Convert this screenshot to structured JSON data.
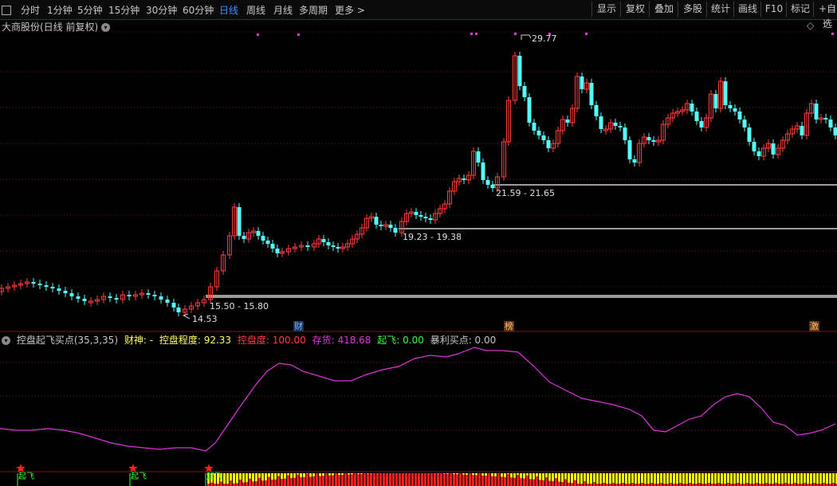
{
  "toolbar": {
    "timeframes": [
      "分时",
      "1分钟",
      "5分钟",
      "15分钟",
      "30分钟",
      "60分钟",
      "日线",
      "周线",
      "月线",
      "多周期",
      "更多 >"
    ],
    "active_timeframe": "日线",
    "buttons": [
      "显示",
      "复权",
      "叠加",
      "多股",
      "统计",
      "画线",
      "F10",
      "标记",
      "+自选"
    ]
  },
  "stock": {
    "title": "大商股份(日线 前复权)"
  },
  "price_labels": {
    "high": "29.77",
    "low": "14.53",
    "zone1": "15.50 - 15.80",
    "zone2": "19.23 - 19.38",
    "zone3": "21.59 - 21.65"
  },
  "event_tags": [
    {
      "text": "财",
      "color": "#4a8cd6"
    },
    {
      "text": "榜",
      "color": "#e08a2a"
    },
    {
      "text": "激",
      "color": "#e08a2a"
    }
  ],
  "indicator": {
    "name": "控盘起飞买点(35,3,35)",
    "caishen": "财神: -",
    "control_degree_label": "控盘程度: 92.33",
    "control_label": "控盘度: 100.00",
    "inventory_label": "存货: 418.68",
    "takeoff_label": "起飞: 0.00",
    "profit_buy_label": "暴利买点: 0.00",
    "signal_label": "起飞"
  },
  "colors": {
    "up": "#ff3c3c",
    "down": "#54fcfc",
    "grid": "#6e1616",
    "curve": "#dd33dd",
    "bar_red": "#ff2020",
    "bar_yellow": "#ffff00",
    "caishen": "#ffff66",
    "control_degree": "#ffff66",
    "control": "#ff3c3c",
    "inventory": "#dd33dd",
    "takeoff": "#33ff33",
    "profit": "#c8c8c8"
  }
}
